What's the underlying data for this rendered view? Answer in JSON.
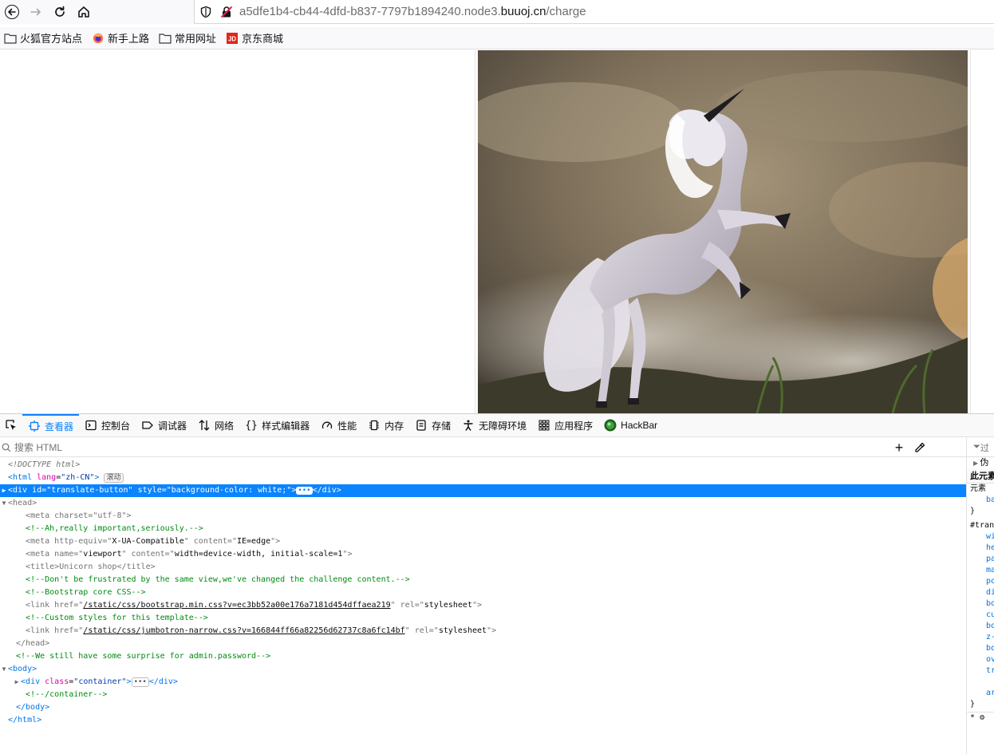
{
  "browser": {
    "url_prefix": "a5dfe1b4-cb44-4dfd-b837-7797b1894240.node3.",
    "url_domain": "buuoj.cn",
    "url_path": "/charge"
  },
  "bookmarks": [
    {
      "label": "火狐官方站点",
      "icon": "folder-icon"
    },
    {
      "label": "新手上路",
      "icon": "firefox-icon"
    },
    {
      "label": "常用网址",
      "icon": "folder-icon"
    },
    {
      "label": "京东商城",
      "icon": "jd-icon"
    }
  ],
  "devtools": {
    "tabs": [
      {
        "label": "查看器"
      },
      {
        "label": "控制台"
      },
      {
        "label": "调试器"
      },
      {
        "label": "网络"
      },
      {
        "label": "样式编辑器"
      },
      {
        "label": "性能"
      },
      {
        "label": "内存"
      },
      {
        "label": "存储"
      },
      {
        "label": "无障碍环境"
      },
      {
        "label": "应用程序"
      },
      {
        "label": "HackBar"
      }
    ],
    "search_placeholder": "搜索 HTML",
    "scroll_badge": "滚动",
    "side": {
      "filter": "过",
      "pseudo": "伪",
      "this_element": "此元素",
      "element_label": "元素",
      "element_prop": "ba",
      "brace": "}",
      "selector": "#tran",
      "props": [
        "wi",
        "he",
        "pa",
        "ma",
        "po",
        "di",
        "bo",
        "cu",
        "bo",
        "z-",
        "bo",
        "ov",
        "tr",
        "",
        "ar"
      ],
      "star": "*"
    },
    "tree": {
      "doctype": "<!DOCTYPE html>",
      "html_lang": "zh-CN",
      "div_id": "translate-button",
      "div_style": "background-color: white;",
      "meta_charset": "utf-8",
      "comment1": "<!--Ah,really important,seriously.-->",
      "meta_http_equiv": "X-UA-Compatible",
      "meta_http_content": "IE=edge",
      "meta_name": "viewport",
      "meta_content": "width=device-width, initial-scale=1",
      "title": "Unicorn shop",
      "comment2": "<!--Don't be frustrated by the same view,we've changed the challenge content.-->",
      "comment3": "<!--Bootstrap core CSS-->",
      "link1_href": "/static/css/bootstrap.min.css?v=ec3bb52a00e176a7181d454dffaea219",
      "link_rel": "stylesheet",
      "comment4": "<!--Custom styles for this template-->",
      "link2_href": "/static/css/jumbotron-narrow.css?v=166844ff66a82256d62737c8a6fc14bf",
      "comment5": "<!--We still have some surprise for admin.password-->",
      "div_class": "container",
      "comment6": "<!--/container-->"
    }
  }
}
